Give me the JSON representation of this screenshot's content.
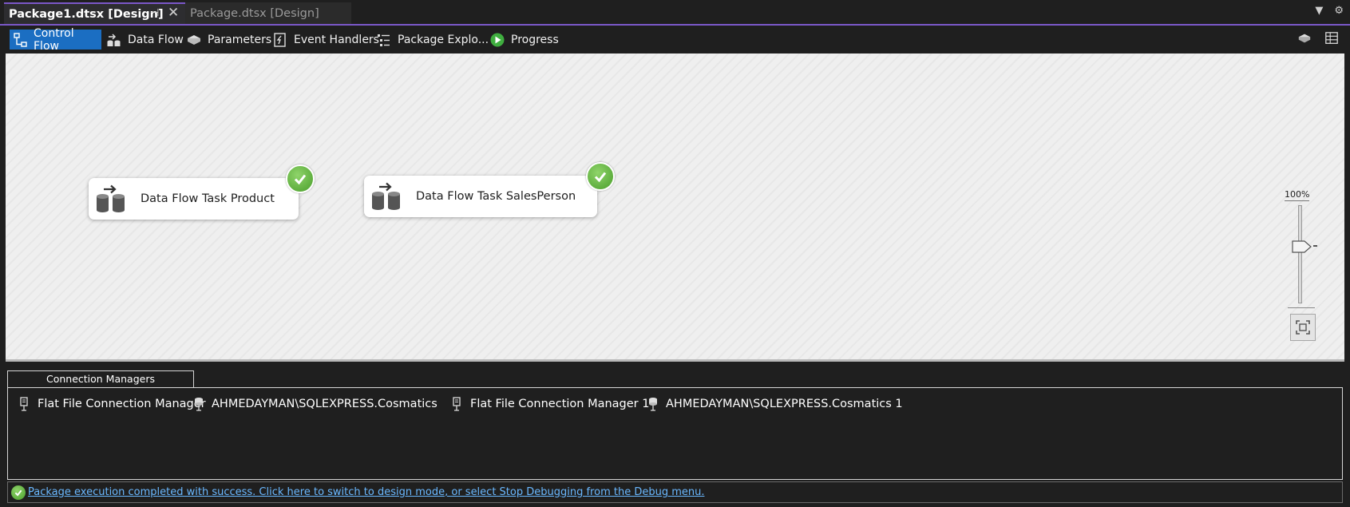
{
  "doc_tabs": [
    {
      "label": "Package1.dtsx [Design]",
      "active": true
    },
    {
      "label": "Package.dtsx [Design]",
      "active": false
    }
  ],
  "designer_tabs": [
    {
      "label": "Control Flow",
      "icon": "control-flow-icon",
      "selected": true
    },
    {
      "label": "Data Flow",
      "icon": "data-flow-icon",
      "selected": false
    },
    {
      "label": "Parameters",
      "icon": "parameters-icon",
      "selected": false
    },
    {
      "label": "Event Handlers",
      "icon": "event-handlers-icon",
      "selected": false
    },
    {
      "label": "Package Explo...",
      "icon": "package-explorer-icon",
      "selected": false
    },
    {
      "label": "Progress",
      "icon": "progress-icon",
      "selected": false
    }
  ],
  "canvas": {
    "tasks": [
      {
        "label": "Data Flow Task Product",
        "status": "success"
      },
      {
        "label": "Data Flow Task SalesPerson",
        "status": "success"
      }
    ],
    "zoom": {
      "label": "100%",
      "value_percent": 100
    }
  },
  "connection_managers": {
    "tab_label": "Connection Managers",
    "items": [
      {
        "label": "Flat File Connection Manager",
        "icon": "flat-file-connection-icon"
      },
      {
        "label": "AHMEDAYMAN\\SQLEXPRESS.Cosmatics",
        "icon": "database-connection-icon"
      },
      {
        "label": "Flat File Connection Manager 1",
        "icon": "flat-file-connection-icon"
      },
      {
        "label": "AHMEDAYMAN\\SQLEXPRESS.Cosmatics 1",
        "icon": "database-connection-icon"
      }
    ]
  },
  "status": {
    "message": "Package execution completed with success. Click here to switch to design mode, or select Stop Debugging from the Debug menu.",
    "icon": "success-check-icon"
  },
  "colors": {
    "accent": "#7b58c9",
    "selected_tab": "#1b6ec2",
    "success": "#4a9e2c",
    "link": "#6ab8ff"
  }
}
